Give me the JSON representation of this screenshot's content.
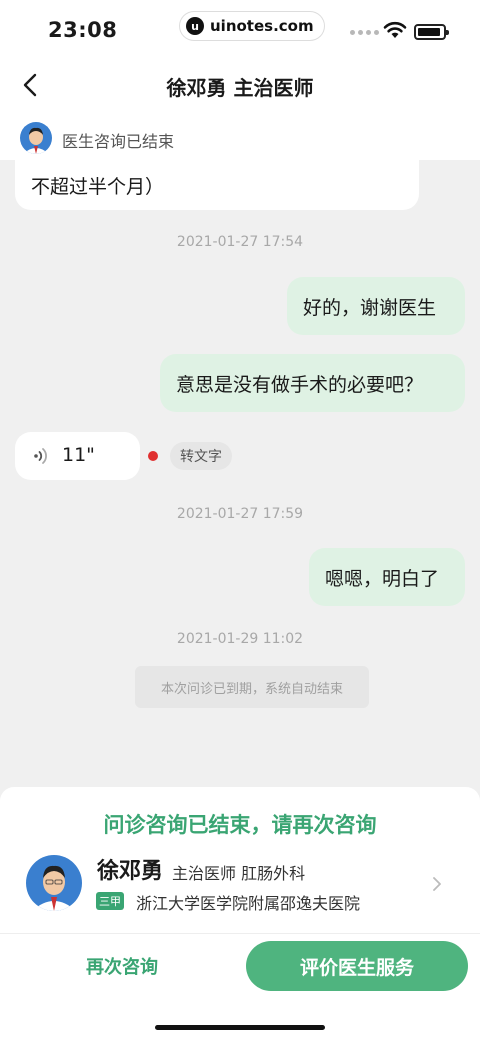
{
  "status_bar": {
    "time": "23:08",
    "watermark_logo": "u",
    "watermark_text": "uinotes.com",
    "icons": [
      "signal-icon",
      "wifi-icon",
      "battery-icon"
    ]
  },
  "nav": {
    "title": "徐邓勇 主治医师",
    "back_icon": "chevron-left-icon"
  },
  "consult_status": {
    "text": "医生咨询已结束"
  },
  "messages": [
    {
      "side": "left",
      "type": "text",
      "text": "不超过半个月）"
    },
    {
      "type": "timestamp",
      "text": "2021-01-27 17:54"
    },
    {
      "side": "right",
      "type": "text",
      "text": "好的，谢谢医生"
    },
    {
      "side": "right",
      "type": "text",
      "text": "意思是没有做手术的必要吧？"
    },
    {
      "side": "left",
      "type": "voice",
      "duration": "11\"",
      "convert_label": "转文字"
    },
    {
      "type": "timestamp",
      "text": "2021-01-27 17:59"
    },
    {
      "side": "right",
      "type": "text",
      "text": "嗯嗯，明白了"
    },
    {
      "type": "timestamp",
      "text": "2021-01-29 11:02"
    },
    {
      "type": "system",
      "text": "本次问诊已到期，系统自动结束"
    }
  ],
  "bottom_card": {
    "headline": "问诊咨询已结束，请再次咨询",
    "doctor_name": "徐邓勇",
    "doctor_title": "主治医师 肛肠外科",
    "hospital_badge": "三甲",
    "hospital": "浙江大学医学院附属邵逸夫医院",
    "reconsult_label": "再次咨询",
    "rate_label": "评价医生服务"
  },
  "colors": {
    "accent_green": "#3aa573",
    "button_green": "#4fb47f",
    "right_bubble": "#dff2e4",
    "chat_background": "#f0f0f0",
    "unread_dot": "#e03030"
  }
}
